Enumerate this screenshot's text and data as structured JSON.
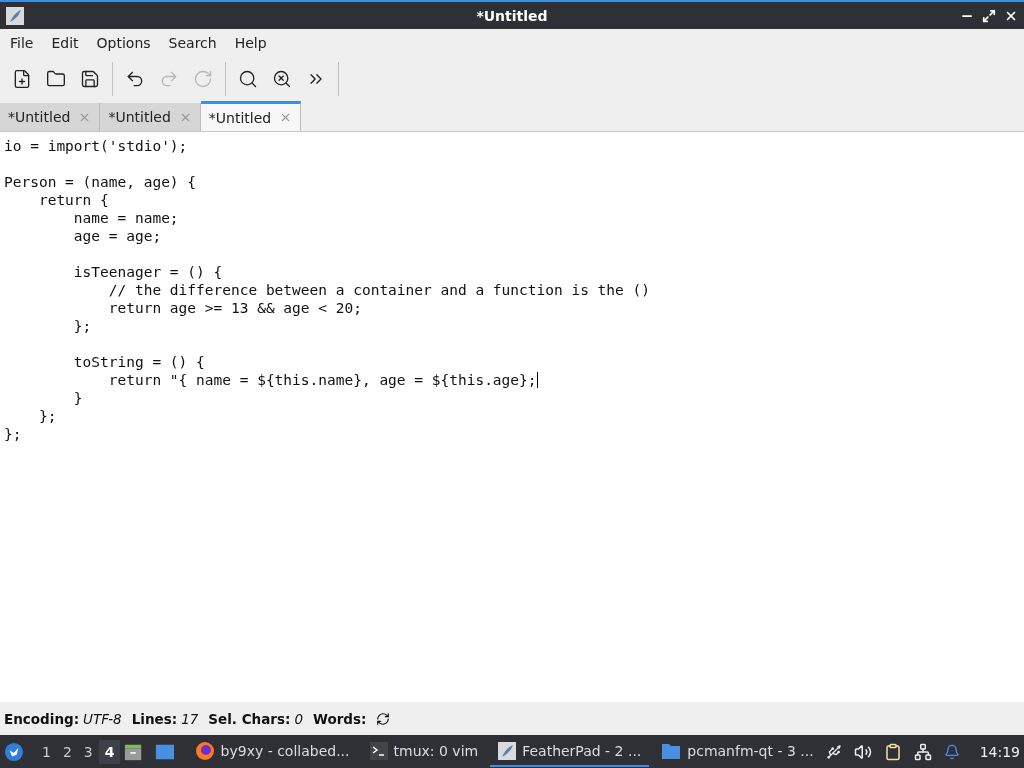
{
  "window": {
    "title": "*Untitled"
  },
  "menu": [
    "File",
    "Edit",
    "Options",
    "Search",
    "Help"
  ],
  "toolbar": [
    {
      "kind": "new",
      "disabled": false
    },
    {
      "kind": "open",
      "disabled": false
    },
    {
      "kind": "save",
      "disabled": false
    },
    {
      "kind": "sep"
    },
    {
      "kind": "undo",
      "disabled": false
    },
    {
      "kind": "redo",
      "disabled": true
    },
    {
      "kind": "reload",
      "disabled": true
    },
    {
      "kind": "sep"
    },
    {
      "kind": "find",
      "disabled": false
    },
    {
      "kind": "replace",
      "disabled": false
    },
    {
      "kind": "more",
      "disabled": false
    }
  ],
  "tabs": [
    {
      "label": "*Untitled",
      "selected": false
    },
    {
      "label": "*Untitled",
      "selected": false
    },
    {
      "label": "*Untitled",
      "selected": true
    }
  ],
  "editor": {
    "lines": [
      {
        "kind": "code",
        "text": "io = import('stdio');",
        "cursor": false
      },
      {
        "kind": "blank"
      },
      {
        "kind": "code",
        "text": "Person = (name, age) {",
        "cursor": false
      },
      {
        "kind": "code",
        "text": "    return {",
        "cursor": false
      },
      {
        "kind": "code",
        "text": "        name = name;",
        "cursor": false
      },
      {
        "kind": "code",
        "text": "        age = age;",
        "cursor": false
      },
      {
        "kind": "blank"
      },
      {
        "kind": "code",
        "text": "        isTeenager = () {",
        "cursor": false
      },
      {
        "kind": "code",
        "text": "            // the difference between a container and a function is the ()",
        "cursor": false
      },
      {
        "kind": "code",
        "text": "            return age >= 13 && age < 20;",
        "cursor": false
      },
      {
        "kind": "code",
        "text": "        };",
        "cursor": false
      },
      {
        "kind": "blank"
      },
      {
        "kind": "code",
        "text": "        toString = () {",
        "cursor": false
      },
      {
        "kind": "code",
        "text": "            return \"{ name = ${this.name}, age = ${this.age};",
        "cursor": true
      },
      {
        "kind": "code",
        "text": "        }",
        "cursor": false
      },
      {
        "kind": "code",
        "text": "    };",
        "cursor": false
      },
      {
        "kind": "code",
        "text": "};",
        "cursor": false
      }
    ]
  },
  "status_bar": {
    "encoding_label": "Encoding:",
    "encoding": "UTF-8",
    "lines_label": "Lines:",
    "lines": "17",
    "sel_label": "Sel. Chars:",
    "sel": "0",
    "words_label": "Words:"
  },
  "taskbar": {
    "desktops": [
      {
        "label": "1",
        "selected": false
      },
      {
        "label": "2",
        "selected": false
      },
      {
        "label": "3",
        "selected": false
      },
      {
        "label": "4",
        "selected": true
      }
    ],
    "tasks": [
      {
        "kind": "browser",
        "label": "by9xy - collabed...",
        "selected": false
      },
      {
        "kind": "terminal",
        "label": "tmux: 0 vim",
        "selected": false
      },
      {
        "kind": "editor",
        "label": "FeatherPad - 2 ...",
        "selected": true
      },
      {
        "kind": "folder",
        "label": "pcmanfm-qt - 3 ...",
        "selected": false
      }
    ],
    "clock": "14:19"
  }
}
